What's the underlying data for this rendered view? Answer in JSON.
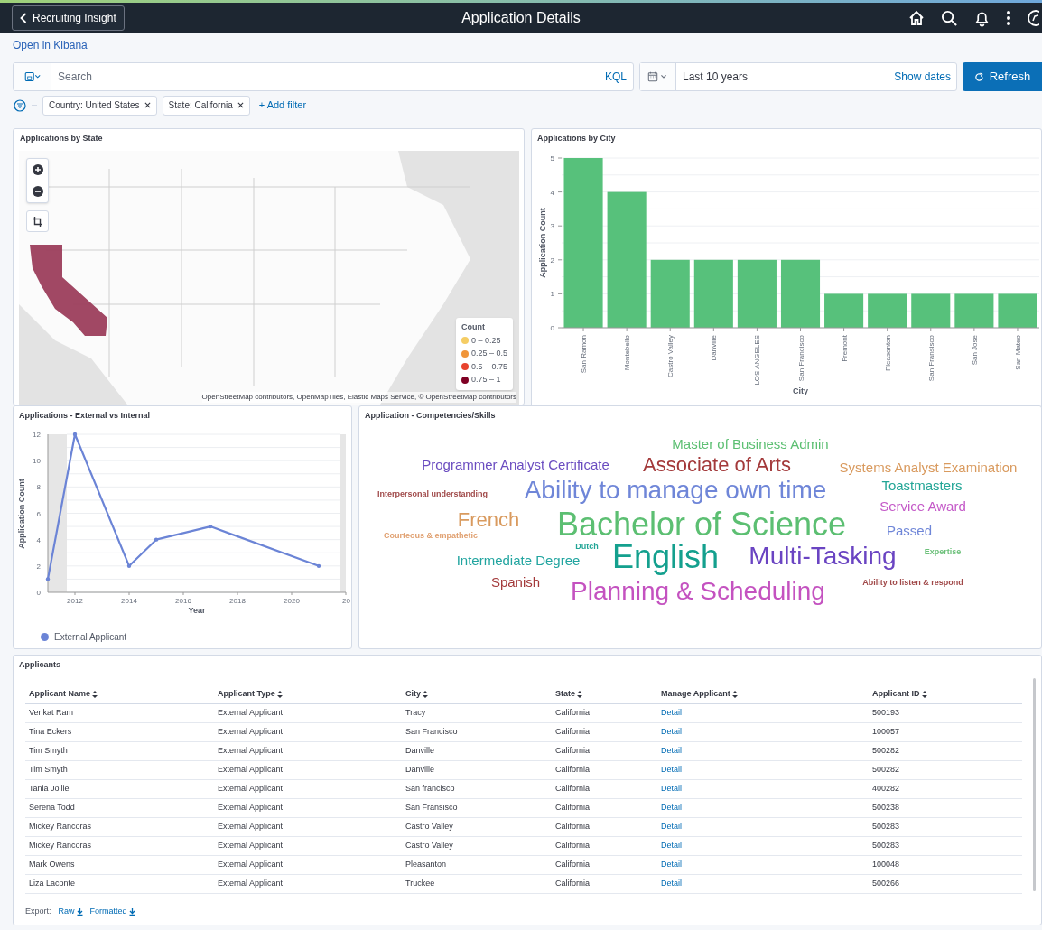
{
  "header": {
    "back_label": "Recruiting Insight",
    "title": "Application Details"
  },
  "kibana_link": "Open in Kibana",
  "query_bar": {
    "placeholder": "Search",
    "language": "KQL",
    "time_range": "Last 10 years",
    "show_dates": "Show dates",
    "refresh": "Refresh"
  },
  "filters": {
    "pills": [
      {
        "label": "Country: United States"
      },
      {
        "label": "State: California"
      }
    ],
    "add": "+ Add filter"
  },
  "map_panel": {
    "title": "Applications by State",
    "legend_title": "Count",
    "legend": [
      {
        "label": "0 – 0.25",
        "color": "#f5cd64"
      },
      {
        "label": "0.25 – 0.5",
        "color": "#f0953a"
      },
      {
        "label": "0.5 – 0.75",
        "color": "#e8432e"
      },
      {
        "label": "0.75 – 1",
        "color": "#7f0024"
      }
    ],
    "attribution": "OpenStreetMap contributors, OpenMapTiles, Elastic Maps Service, © OpenStreetMap contributors"
  },
  "city_panel": {
    "title": "Applications by City",
    "chart_data": {
      "type": "bar",
      "xlabel": "City",
      "ylabel": "Application Count",
      "categories": [
        "San Ramon",
        "Montebello",
        "Castro Valley",
        "Danville",
        "LOS ANGELES",
        "San Francisco",
        "Fremont",
        "Pleasanton",
        "San Fransisco",
        "San Jose",
        "San Mateo"
      ],
      "values": [
        5,
        4,
        2,
        2,
        2,
        2,
        1,
        1,
        1,
        1,
        1
      ],
      "ylim": [
        0,
        5
      ],
      "yticks": [
        0,
        1,
        2,
        3,
        4,
        5
      ],
      "grid": true
    }
  },
  "type_panel": {
    "title": "Applications - External vs Internal",
    "cut_tick_label": "20",
    "chart_data": {
      "type": "line",
      "xlabel": "Year",
      "ylabel": "Application Count",
      "x": [
        2011,
        2012,
        2014,
        2015,
        2017,
        2021
      ],
      "series": [
        {
          "name": "External Applicant",
          "color": "#6b84d6",
          "values": [
            1,
            12,
            2,
            4,
            5,
            2
          ]
        }
      ],
      "xlim": [
        2011,
        2022
      ],
      "ylim": [
        0,
        12
      ],
      "xticks": [
        2012,
        2014,
        2016,
        2018,
        2020
      ],
      "yticks": [
        0,
        2,
        4,
        6,
        8,
        10,
        12
      ],
      "grid": true
    }
  },
  "skills_panel": {
    "title": "Application - Competencies/Skills",
    "words": [
      {
        "text": "Master of Business Admin",
        "color": "#5cbf72",
        "kind": "small"
      },
      {
        "text": "Programmer Analyst Certificate",
        "color": "#6a4cc0",
        "kind": "small"
      },
      {
        "text": "Associate of Arts",
        "color": "#a3393a",
        "kind": "medium"
      },
      {
        "text": "Systems Analyst Examination",
        "color": "#d99a5e",
        "kind": "small"
      },
      {
        "text": "Interpersonal understanding",
        "color": "#a04a4a",
        "kind": "tiny"
      },
      {
        "text": "Ability to manage own time",
        "color": "#6f86d8",
        "kind": "large"
      },
      {
        "text": "Toastmasters",
        "color": "#22a596",
        "kind": "small"
      },
      {
        "text": "Service Award",
        "color": "#c45ac8",
        "kind": "small"
      },
      {
        "text": "French",
        "color": "#d99a5e",
        "kind": "medium"
      },
      {
        "text": "Courteous & empathetic",
        "color": "#e0a070",
        "kind": "tiny"
      },
      {
        "text": "Bachelor of Science",
        "color": "#5cbf72",
        "kind": "largest"
      },
      {
        "text": "Passed",
        "color": "#6f86d8",
        "kind": "small"
      },
      {
        "text": "Dutch",
        "color": "#22a596",
        "kind": "tiny"
      },
      {
        "text": "Intermediate Degree",
        "color": "#22a5a0",
        "kind": "small"
      },
      {
        "text": "English",
        "color": "#14a08e",
        "kind": "largest"
      },
      {
        "text": "Multi-Tasking",
        "color": "#6a44c2",
        "kind": "large"
      },
      {
        "text": "Expertise",
        "color": "#6cc07a",
        "kind": "tiny"
      },
      {
        "text": "Spanish",
        "color": "#a3393a",
        "kind": "small"
      },
      {
        "text": "Planning & Scheduling",
        "color": "#c452c0",
        "kind": "large"
      },
      {
        "text": "Ability to listen & respond",
        "color": "#a04848",
        "kind": "tiny"
      }
    ]
  },
  "applicants": {
    "title": "Applicants",
    "columns": [
      {
        "label": "Applicant Name",
        "kind": "text"
      },
      {
        "label": "Applicant Type",
        "kind": "text"
      },
      {
        "label": "City",
        "kind": "text"
      },
      {
        "label": "State",
        "kind": "text"
      },
      {
        "label": "Manage Applicant",
        "kind": "link"
      },
      {
        "label": "Applicant ID",
        "kind": "text"
      }
    ],
    "rows": [
      [
        "Venkat Ram",
        "External Applicant",
        "Tracy",
        "California",
        "Detail",
        "500193"
      ],
      [
        "Tina Eckers",
        "External Applicant",
        "San Francisco",
        "California",
        "Detail",
        "100057"
      ],
      [
        "Tim Smyth",
        "External Applicant",
        "Danville",
        "California",
        "Detail",
        "500282"
      ],
      [
        "Tim Smyth",
        "External Applicant",
        "Danville",
        "California",
        "Detail",
        "500282"
      ],
      [
        "Tania Jollie",
        "External Applicant",
        "San francisco",
        "California",
        "Detail",
        "400282"
      ],
      [
        "Serena Todd",
        "External Applicant",
        "San Fransisco",
        "California",
        "Detail",
        "500238"
      ],
      [
        "Mickey Rancoras",
        "External Applicant",
        "Castro Valley",
        "California",
        "Detail",
        "500283"
      ],
      [
        "Mickey Rancoras",
        "External Applicant",
        "Castro Valley",
        "California",
        "Detail",
        "500283"
      ],
      [
        "Mark Owens",
        "External Applicant",
        "Pleasanton",
        "California",
        "Detail",
        "100048"
      ],
      [
        "Liza Laconte",
        "External Applicant",
        "Truckee",
        "California",
        "Detail",
        "500266"
      ]
    ],
    "export": {
      "label": "Export:",
      "links": [
        "Raw",
        "Formatted"
      ]
    }
  }
}
